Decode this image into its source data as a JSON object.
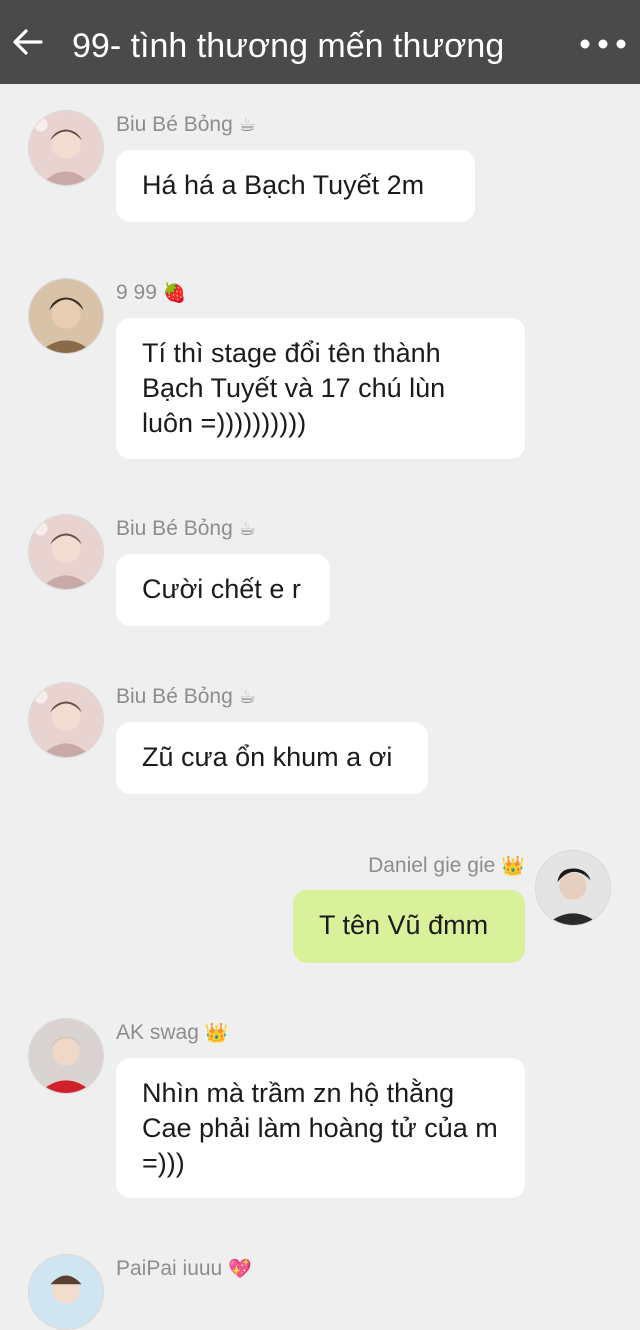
{
  "header": {
    "title": "99- tình thương mến thương",
    "back_icon": "arrow-left-icon",
    "menu_icon": "more-dots-icon"
  },
  "messages": [
    {
      "sender": "Biu Bé Bỏng",
      "emoji": "☕",
      "text": "Há há a Bạch Tuyết 2m",
      "mine": false
    },
    {
      "sender": "9 99",
      "emoji": "🍓",
      "text": "Tí thì stage đổi tên thành Bạch Tuyết và 17 chú lùn luôn =))))))))))",
      "mine": false
    },
    {
      "sender": "Biu Bé Bỏng",
      "emoji": "☕",
      "text": "Cười chết e r",
      "mine": false
    },
    {
      "sender": "Biu Bé Bỏng",
      "emoji": "☕",
      "text": "Zũ cưa ổn khum a ơi",
      "mine": false
    },
    {
      "sender": "Daniel gie gie",
      "emoji": "👑",
      "text": "T tên Vũ đmm",
      "mine": true
    },
    {
      "sender": "AK swag",
      "emoji": "👑",
      "text": "Nhìn mà trầm zn hộ thằng Cae phải làm hoàng tử của m =)))",
      "mine": false
    },
    {
      "sender": "PaiPai iuuu",
      "emoji": "💖",
      "text": "",
      "mine": false
    }
  ],
  "colors": {
    "header_bg": "#4a4a4a",
    "chat_bg": "#efefef",
    "bubble_other": "#ffffff",
    "bubble_mine": "#d9f19a"
  }
}
